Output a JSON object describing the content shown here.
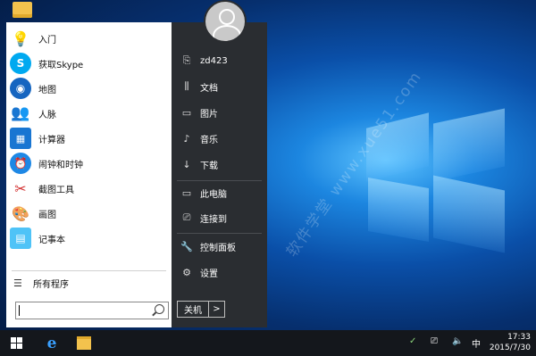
{
  "start_menu": {
    "apps": [
      {
        "label": "入门",
        "icon": "lightbulb-icon",
        "color": "#1e88e5"
      },
      {
        "label": "获取Skype",
        "icon": "skype-icon",
        "color": "#00a9f0"
      },
      {
        "label": "地图",
        "icon": "map-pin-icon",
        "color": "#1565c0"
      },
      {
        "label": "人脉",
        "icon": "people-icon",
        "color": "#1e88e5"
      },
      {
        "label": "计算器",
        "icon": "calculator-icon",
        "color": "#1976d2"
      },
      {
        "label": "闹钟和时钟",
        "icon": "alarm-clock-icon",
        "color": "#1e88e5"
      },
      {
        "label": "截图工具",
        "icon": "scissors-icon",
        "color": "#d32f2f"
      },
      {
        "label": "画图",
        "icon": "palette-icon",
        "color": "#f9a825"
      },
      {
        "label": "记事本",
        "icon": "notepad-icon",
        "color": "#4fc3f7"
      }
    ],
    "all_programs": "所有程序",
    "search_value": "",
    "user": {
      "name": "zd423"
    },
    "right_items": [
      {
        "label": "文档",
        "icon": "documents-icon"
      },
      {
        "label": "图片",
        "icon": "pictures-icon"
      },
      {
        "label": "音乐",
        "icon": "music-icon"
      },
      {
        "label": "下载",
        "icon": "download-icon"
      },
      {
        "label": "此电脑",
        "icon": "computer-icon"
      },
      {
        "label": "连接到",
        "icon": "connect-icon"
      },
      {
        "label": "控制面板",
        "icon": "control-panel-icon"
      },
      {
        "label": "设置",
        "icon": "settings-gear-icon"
      }
    ],
    "shutdown_label": "关机"
  },
  "taskbar": {
    "tray_language": "中",
    "clock_time": "17:33",
    "clock_date": "2015/7/30"
  },
  "watermark": "软件学堂 www.xue51.com",
  "colors": {
    "start_right_bg": "#2a2d31",
    "taskbar_bg": "#14171c",
    "accent": "#1e88e5"
  }
}
